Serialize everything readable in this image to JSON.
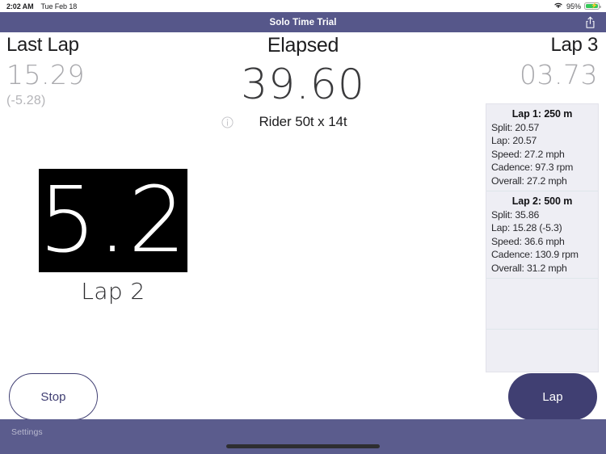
{
  "status_bar": {
    "time": "2:02 AM",
    "date": "Tue Feb 18",
    "battery_percent": "95%",
    "wifi_icon": "wifi-icon",
    "battery_icon": "battery-charging-icon"
  },
  "nav": {
    "title": "Solo Time Trial",
    "share_icon": "share-icon"
  },
  "readouts": {
    "left": {
      "label": "Last Lap",
      "value": "15.29",
      "delta": "(-5.28)"
    },
    "center": {
      "label": "Elapsed",
      "value": "39.60",
      "gearing": "Rider 50t x 14t",
      "info_icon": "info-circle-icon"
    },
    "right": {
      "label": "Lap 3",
      "value": "03.73"
    }
  },
  "countdown": {
    "value": "5.2",
    "label": "Lap 2"
  },
  "laps": [
    {
      "title": "Lap 1: 250 m",
      "split": "Split: 20.57",
      "lap": "Lap: 20.57",
      "speed": "Speed: 27.2 mph",
      "cadence": "Cadence: 97.3 rpm",
      "overall": "Overall: 27.2 mph"
    },
    {
      "title": "Lap 2: 500 m",
      "split": "Split: 35.86",
      "lap": "Lap: 15.28 (-5.3)",
      "speed": "Speed: 36.6 mph",
      "cadence": "Cadence: 130.9 rpm",
      "overall": "Overall: 31.2 mph"
    }
  ],
  "actions": {
    "stop_label": "Stop",
    "lap_label": "Lap"
  },
  "bottom_bar": {
    "settings_label": "Settings"
  },
  "colors": {
    "nav_purple": "#56578a",
    "bottom_purple": "#5b5c8d",
    "lap_button": "#403f72",
    "stop_outline": "#3f3e72",
    "panel_bg": "#eeeef4",
    "battery_green": "#35c759"
  }
}
